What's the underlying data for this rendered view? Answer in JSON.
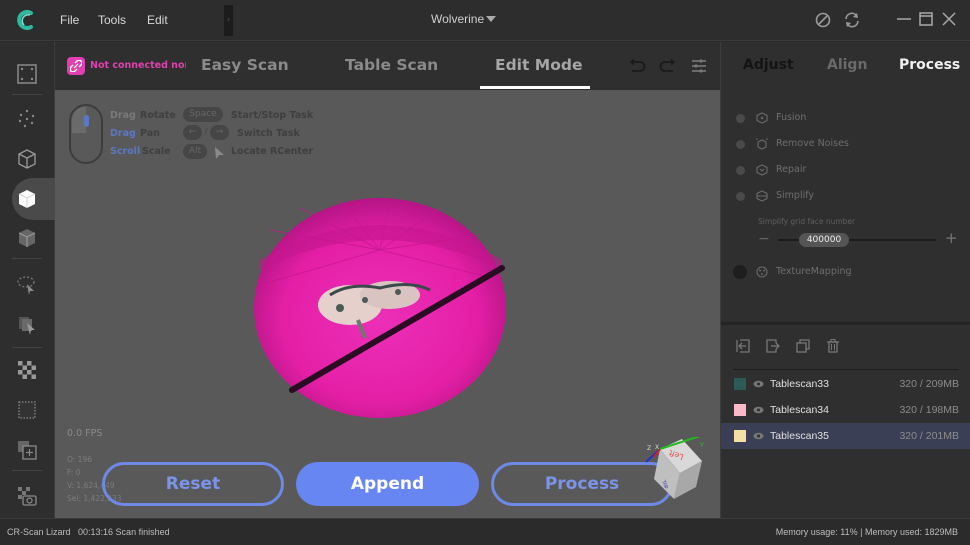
{
  "titlebar": {
    "menu": [
      "File",
      "Tools",
      "Edit"
    ],
    "project_name": "Wolverine",
    "icons": [
      "logo-icon",
      "collapse-icon",
      "screenshot-icon",
      "sync-icon",
      "minimize-icon",
      "maximize-icon",
      "close-icon"
    ]
  },
  "tabbar": {
    "connection_status": "Not connected norm",
    "modes": [
      "Easy Scan",
      "Table Scan",
      "Edit Mode"
    ],
    "active_mode": "Edit Mode",
    "icons": [
      "undo-icon",
      "redo-icon",
      "settings-list-icon"
    ]
  },
  "hints": {
    "mouse": [
      {
        "action": "Drag",
        "effect": "Rotate"
      },
      {
        "action": "Drag",
        "effect": "Pan"
      },
      {
        "action": "Scroll",
        "effect": "Scale"
      }
    ],
    "keys": [
      {
        "key": "Space",
        "effect": "Start/Stop Task"
      },
      {
        "key": "← / →",
        "effect": "Switch Task"
      },
      {
        "key": "Alt",
        "effect": "Locate RCenter"
      }
    ]
  },
  "viewport": {
    "fps": "0.0 FPS",
    "stats": [
      "O: 196",
      "F: 0",
      "V: 1,624,449",
      "Sel: 1,422,233"
    ],
    "buttons": {
      "reset": "Reset",
      "append": "Append",
      "process": "Process"
    },
    "orientation_cube": {
      "face_labels": [
        "Left",
        "Top"
      ],
      "axes": [
        "X",
        "Y",
        "Z"
      ]
    }
  },
  "right_panel": {
    "tabs": [
      "Adjust",
      "Align",
      "Process"
    ],
    "active_tab": "Process",
    "process_steps": [
      "Fusion",
      "Remove Noises",
      "Repair",
      "Simplify"
    ],
    "simplify": {
      "label": "Simplify grid face number",
      "value": "400000",
      "minus": "−",
      "plus": "+"
    },
    "texture_mapping": "TextureMapping",
    "list_tools": [
      "import-icon",
      "export-icon",
      "duplicate-icon",
      "delete-icon"
    ],
    "scans": [
      {
        "name": "Tablescan33",
        "size": "320 / 209MB",
        "color": "#2e5a55",
        "selected": false
      },
      {
        "name": "Tablescan34",
        "size": "320 / 198MB",
        "color": "#f7b9c8",
        "selected": false
      },
      {
        "name": "Tablescan35",
        "size": "320 / 201MB",
        "color": "#f6dfa4",
        "selected": true
      }
    ]
  },
  "statusbar": {
    "left": "CR-Scan Lizard   00:13:16 Scan finished",
    "right": "Memory usage: 11% | Memory used: 1829MB"
  },
  "colors": {
    "accent_blue": "#6886f2",
    "brand_pink": "#e23fb0",
    "selected_row": "#3b3f55"
  }
}
